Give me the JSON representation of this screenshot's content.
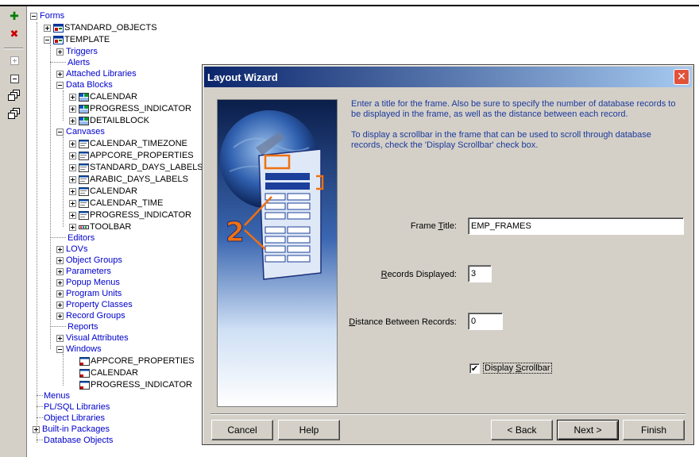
{
  "toolbar": {
    "create_icon": "green-plus",
    "delete_icon": "red-x",
    "expand_icon": "expand-box",
    "collapse_icon": "collapse-box",
    "expand_all_icon": "stack-plus",
    "collapse_all_icon": "stack-minus"
  },
  "tree": {
    "forms": "Forms",
    "standard_objects": "STANDARD_OBJECTS",
    "template": "TEMPLATE",
    "triggers": "Triggers",
    "alerts": "Alerts",
    "attached_libraries": "Attached Libraries",
    "data_blocks": "Data Blocks",
    "db_calendar": "CALENDAR",
    "db_progress": "PROGRESS_INDICATOR",
    "db_detail": "DETAILBLOCK",
    "canvases": "Canvases",
    "cv_calendar_timezone": "CALENDAR_TIMEZONE",
    "cv_appcore": "APPCORE_PROPERTIES",
    "cv_std_days": "STANDARD_DAYS_LABELS",
    "cv_arabic_days": "ARABIC_DAYS_LABELS",
    "cv_calendar": "CALENDAR",
    "cv_calendar_time": "CALENDAR_TIME",
    "cv_progress": "PROGRESS_INDICATOR",
    "cv_toolbar": "TOOLBAR",
    "editors": "Editors",
    "lovs": "LOVs",
    "object_groups": "Object Groups",
    "parameters": "Parameters",
    "popup_menus": "Popup Menus",
    "program_units": "Program Units",
    "property_classes": "Property Classes",
    "record_groups": "Record Groups",
    "reports": "Reports",
    "visual_attributes": "Visual Attributes",
    "windows": "Windows",
    "win_appcore": "APPCORE_PROPERTIES",
    "win_calendar": "CALENDAR",
    "win_progress": "PROGRESS_INDICATOR",
    "menus": "Menus",
    "plsql_libraries": "PL/SQL Libraries",
    "object_libraries": "Object Libraries",
    "builtin_packages": "Built-in Packages",
    "database_objects": "Database Objects"
  },
  "dialog": {
    "title": "Layout Wizard",
    "close": "✕",
    "instruction_1": "Enter a title for the frame. Also be sure to specify the number of database records to be displayed in the frame, as well as the distance between each record.",
    "instruction_2": "To display a scrollbar in the frame that can be used to scroll through database records, check the 'Display Scrollbar' check box.",
    "frame_title_label_pre": "Frame ",
    "frame_title_label_u": "T",
    "frame_title_label_post": "itle:",
    "frame_title_value": "EMP_FRAMES",
    "records_label_u": "R",
    "records_label_post": "ecords Displayed:",
    "records_value": "3",
    "distance_label_u": "D",
    "distance_label_post": "istance Between Records:",
    "distance_value": "0",
    "scrollbar_label_pre": "Display ",
    "scrollbar_label_u": "S",
    "scrollbar_label_post": "crollbar",
    "scrollbar_checked": true,
    "step_number": "2",
    "buttons": {
      "cancel": "Cancel",
      "help": "Help",
      "back": "< Back",
      "next": "Next >",
      "finish": "Finish"
    }
  },
  "colors": {
    "title_start": "#0a246a",
    "title_end": "#a6caf0",
    "instruction_text": "#1c3a9c",
    "tree_link": "#0000cc",
    "dialog_face": "#d4d0c8"
  }
}
